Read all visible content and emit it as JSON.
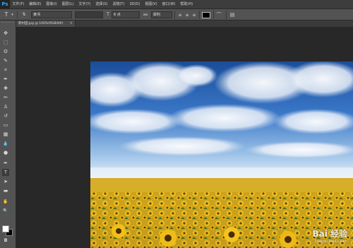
{
  "app": {
    "logo": "Ps"
  },
  "menu": [
    "文件(F)",
    "编辑(E)",
    "图像(I)",
    "图层(L)",
    "文字(Y)",
    "选择(S)",
    "滤镜(T)",
    "3D(D)",
    "视图(V)",
    "窗口(W)",
    "帮助(H)"
  ],
  "options": {
    "tool_icon": "T",
    "font_family": "隶书",
    "font_size": "6 点",
    "aa_prefix": "aa",
    "antialias": "犀利",
    "text_color": "#000000"
  },
  "document": {
    "tab_label": "新村田.jpg @ 100%(RGB/8#)",
    "close": "×"
  },
  "tools": [
    {
      "icon": "move-icon",
      "glyph": "✥"
    },
    {
      "icon": "marquee-icon",
      "glyph": "⬚"
    },
    {
      "icon": "lasso-icon",
      "glyph": "ʘ"
    },
    {
      "icon": "quick-select-icon",
      "glyph": "✎"
    },
    {
      "icon": "crop-icon",
      "glyph": "⌗"
    },
    {
      "icon": "eyedropper-icon",
      "glyph": "✒"
    },
    {
      "icon": "healing-icon",
      "glyph": "✚"
    },
    {
      "icon": "brush-icon",
      "glyph": "✏"
    },
    {
      "icon": "clone-stamp-icon",
      "glyph": "♙"
    },
    {
      "icon": "history-brush-icon",
      "glyph": "↺"
    },
    {
      "icon": "eraser-icon",
      "glyph": "▭"
    },
    {
      "icon": "gradient-icon",
      "glyph": "▦"
    },
    {
      "icon": "blur-icon",
      "glyph": "💧"
    },
    {
      "icon": "dodge-icon",
      "glyph": "●"
    },
    {
      "icon": "pen-icon",
      "glyph": "✒"
    },
    {
      "icon": "type-icon",
      "glyph": "T"
    },
    {
      "icon": "path-select-icon",
      "glyph": "➤"
    },
    {
      "icon": "shape-icon",
      "glyph": "▬"
    },
    {
      "icon": "hand-icon",
      "glyph": "✋"
    },
    {
      "icon": "zoom-icon",
      "glyph": "🔍"
    }
  ],
  "watermark": {
    "main": "Bai 经验",
    "sub": "jingyan.baidu.com"
  },
  "colors": {
    "accent": "#31a8ff",
    "panel": "#535353",
    "workspace": "#282828"
  }
}
